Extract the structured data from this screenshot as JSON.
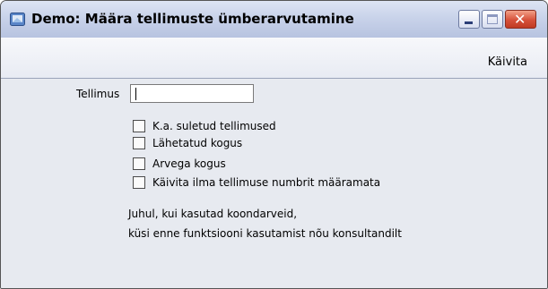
{
  "window": {
    "title": "Demo: Määra tellimuste ümberarvutamine"
  },
  "toolbar": {
    "run_label": "Käivita"
  },
  "form": {
    "order_label": "Tellimus",
    "order_value": "",
    "checkboxes": [
      {
        "label": "K.a. suletud tellimused",
        "checked": false
      },
      {
        "label": "Lähetatud kogus",
        "checked": false
      },
      {
        "label": "Arvega kogus",
        "checked": false
      },
      {
        "label": "Käivita ilma tellimuse numbrit määramata",
        "checked": false
      }
    ],
    "note_lines": [
      "Juhul, kui kasutad koondarveid,",
      "küsi enne funktsiooni kasutamist nõu konsultandilt"
    ]
  },
  "colors": {
    "titlebar": "#c9d3ea",
    "close_button": "#d6513a",
    "background": "#e7eaf0"
  },
  "icons": {
    "app": "app-icon",
    "minimize": "minimize-icon",
    "maximize": "maximize-icon",
    "close": "close-icon"
  }
}
